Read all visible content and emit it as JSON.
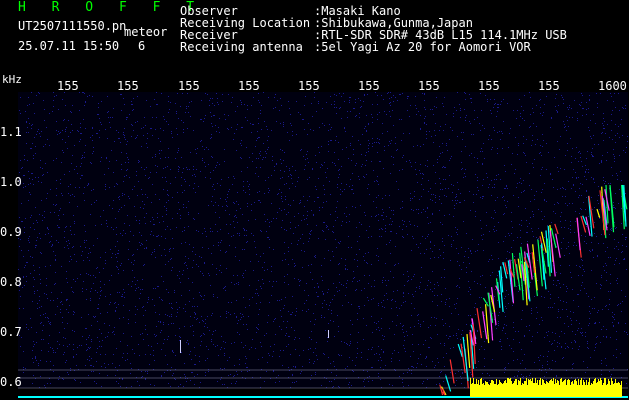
{
  "header": {
    "software": "H R O F F T",
    "filename": "UT2507111550.pn",
    "meteor_label": "meteor",
    "date_time": "25.07.11 15:50",
    "meteor_count": "6"
  },
  "info": [
    {
      "key": "Observer",
      "value": ":Masaki Kano"
    },
    {
      "key": "Receiving Location",
      "value": ":Shibukawa,Gunma,Japan"
    },
    {
      "key": "Receiver",
      "value": ":RTL-SDR SDR# 43dB L15 114.1MHz USB"
    },
    {
      "key": "Receiving antenna",
      "value": ":5el Yagi Az 20 for Aomori VOR"
    }
  ],
  "axis": {
    "y_unit": "kHz",
    "x_ticks": [
      "155",
      "155",
      "155",
      "155",
      "155",
      "155",
      "155",
      "155",
      "155",
      "1600"
    ],
    "y_ticks": [
      "1.1",
      "1.0",
      "0.9",
      "0.8",
      "0.7",
      "0.6"
    ]
  },
  "colors": {
    "axis_text": "#ffffff",
    "header_text": "#00ff00",
    "background_noise": "#1a1a8c",
    "signal": "#ff3030",
    "echo_cyan": "#00ffff",
    "power_bar": "#ffff00",
    "baseline": "#00ffff"
  }
}
